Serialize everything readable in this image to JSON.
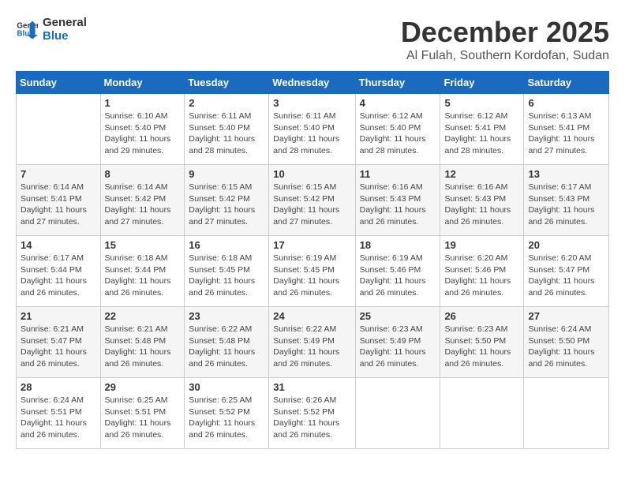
{
  "logo": {
    "line1": "General",
    "line2": "Blue"
  },
  "title": "December 2025",
  "subtitle": "Al Fulah, Southern Kordofan, Sudan",
  "days_header": [
    "Sunday",
    "Monday",
    "Tuesday",
    "Wednesday",
    "Thursday",
    "Friday",
    "Saturday"
  ],
  "weeks": [
    [
      {
        "num": "",
        "info": ""
      },
      {
        "num": "1",
        "info": "Sunrise: 6:10 AM\nSunset: 5:40 PM\nDaylight: 11 hours and 29 minutes."
      },
      {
        "num": "2",
        "info": "Sunrise: 6:11 AM\nSunset: 5:40 PM\nDaylight: 11 hours and 28 minutes."
      },
      {
        "num": "3",
        "info": "Sunrise: 6:11 AM\nSunset: 5:40 PM\nDaylight: 11 hours and 28 minutes."
      },
      {
        "num": "4",
        "info": "Sunrise: 6:12 AM\nSunset: 5:40 PM\nDaylight: 11 hours and 28 minutes."
      },
      {
        "num": "5",
        "info": "Sunrise: 6:12 AM\nSunset: 5:41 PM\nDaylight: 11 hours and 28 minutes."
      },
      {
        "num": "6",
        "info": "Sunrise: 6:13 AM\nSunset: 5:41 PM\nDaylight: 11 hours and 27 minutes."
      }
    ],
    [
      {
        "num": "7",
        "info": "Sunrise: 6:14 AM\nSunset: 5:41 PM\nDaylight: 11 hours and 27 minutes."
      },
      {
        "num": "8",
        "info": "Sunrise: 6:14 AM\nSunset: 5:42 PM\nDaylight: 11 hours and 27 minutes."
      },
      {
        "num": "9",
        "info": "Sunrise: 6:15 AM\nSunset: 5:42 PM\nDaylight: 11 hours and 27 minutes."
      },
      {
        "num": "10",
        "info": "Sunrise: 6:15 AM\nSunset: 5:42 PM\nDaylight: 11 hours and 27 minutes."
      },
      {
        "num": "11",
        "info": "Sunrise: 6:16 AM\nSunset: 5:43 PM\nDaylight: 11 hours and 26 minutes."
      },
      {
        "num": "12",
        "info": "Sunrise: 6:16 AM\nSunset: 5:43 PM\nDaylight: 11 hours and 26 minutes."
      },
      {
        "num": "13",
        "info": "Sunrise: 6:17 AM\nSunset: 5:43 PM\nDaylight: 11 hours and 26 minutes."
      }
    ],
    [
      {
        "num": "14",
        "info": "Sunrise: 6:17 AM\nSunset: 5:44 PM\nDaylight: 11 hours and 26 minutes."
      },
      {
        "num": "15",
        "info": "Sunrise: 6:18 AM\nSunset: 5:44 PM\nDaylight: 11 hours and 26 minutes."
      },
      {
        "num": "16",
        "info": "Sunrise: 6:18 AM\nSunset: 5:45 PM\nDaylight: 11 hours and 26 minutes."
      },
      {
        "num": "17",
        "info": "Sunrise: 6:19 AM\nSunset: 5:45 PM\nDaylight: 11 hours and 26 minutes."
      },
      {
        "num": "18",
        "info": "Sunrise: 6:19 AM\nSunset: 5:46 PM\nDaylight: 11 hours and 26 minutes."
      },
      {
        "num": "19",
        "info": "Sunrise: 6:20 AM\nSunset: 5:46 PM\nDaylight: 11 hours and 26 minutes."
      },
      {
        "num": "20",
        "info": "Sunrise: 6:20 AM\nSunset: 5:47 PM\nDaylight: 11 hours and 26 minutes."
      }
    ],
    [
      {
        "num": "21",
        "info": "Sunrise: 6:21 AM\nSunset: 5:47 PM\nDaylight: 11 hours and 26 minutes."
      },
      {
        "num": "22",
        "info": "Sunrise: 6:21 AM\nSunset: 5:48 PM\nDaylight: 11 hours and 26 minutes."
      },
      {
        "num": "23",
        "info": "Sunrise: 6:22 AM\nSunset: 5:48 PM\nDaylight: 11 hours and 26 minutes."
      },
      {
        "num": "24",
        "info": "Sunrise: 6:22 AM\nSunset: 5:49 PM\nDaylight: 11 hours and 26 minutes."
      },
      {
        "num": "25",
        "info": "Sunrise: 6:23 AM\nSunset: 5:49 PM\nDaylight: 11 hours and 26 minutes."
      },
      {
        "num": "26",
        "info": "Sunrise: 6:23 AM\nSunset: 5:50 PM\nDaylight: 11 hours and 26 minutes."
      },
      {
        "num": "27",
        "info": "Sunrise: 6:24 AM\nSunset: 5:50 PM\nDaylight: 11 hours and 26 minutes."
      }
    ],
    [
      {
        "num": "28",
        "info": "Sunrise: 6:24 AM\nSunset: 5:51 PM\nDaylight: 11 hours and 26 minutes."
      },
      {
        "num": "29",
        "info": "Sunrise: 6:25 AM\nSunset: 5:51 PM\nDaylight: 11 hours and 26 minutes."
      },
      {
        "num": "30",
        "info": "Sunrise: 6:25 AM\nSunset: 5:52 PM\nDaylight: 11 hours and 26 minutes."
      },
      {
        "num": "31",
        "info": "Sunrise: 6:26 AM\nSunset: 5:52 PM\nDaylight: 11 hours and 26 minutes."
      },
      {
        "num": "",
        "info": ""
      },
      {
        "num": "",
        "info": ""
      },
      {
        "num": "",
        "info": ""
      }
    ]
  ]
}
